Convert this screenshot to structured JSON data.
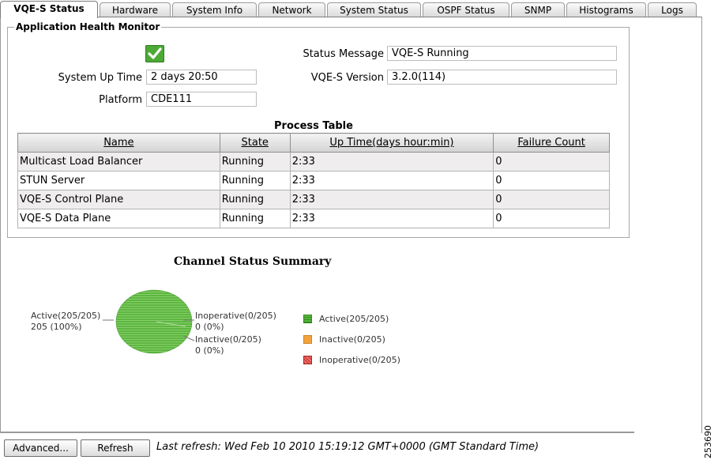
{
  "tabs": [
    {
      "label": "VQE-S Status",
      "active": true
    },
    {
      "label": "Hardware"
    },
    {
      "label": "System Info"
    },
    {
      "label": "Network"
    },
    {
      "label": "System Status"
    },
    {
      "label": "OSPF Status"
    },
    {
      "label": "SNMP"
    },
    {
      "label": "Histograms"
    },
    {
      "label": "Logs"
    }
  ],
  "health": {
    "legend": "Application Health Monitor",
    "status_ok": true,
    "uptime_label": "System Up Time",
    "uptime_value": "2 days 20:50",
    "platform_label": "Platform",
    "platform_value": "CDE111",
    "status_msg_label": "Status Message",
    "status_msg_value": "VQE-S Running",
    "version_label": "VQE-S Version",
    "version_value": "3.2.0(114)"
  },
  "process_table": {
    "title": "Process Table",
    "columns": [
      "Name",
      "State",
      "Up Time(days hour:min)",
      "Failure Count"
    ],
    "rows": [
      [
        "Multicast Load Balancer",
        "Running",
        "2:33",
        "0"
      ],
      [
        "STUN Server",
        "Running",
        "2:33",
        "0"
      ],
      [
        "VQE-S Control Plane",
        "Running",
        "2:33",
        "0"
      ],
      [
        "VQE-S Data Plane",
        "Running",
        "2:33",
        "0"
      ]
    ]
  },
  "chart_data": {
    "type": "pie",
    "title": "Channel Status Summary",
    "categories": [
      "Active",
      "Inactive",
      "Inoperative"
    ],
    "values": [
      205,
      0,
      0
    ],
    "slice_labels": [
      {
        "line1": "Active(205/205)",
        "line2": "205 (100%)"
      },
      {
        "line1": "Inactive(0/205)",
        "line2": "0 (0%)"
      },
      {
        "line1": "Inoperative(0/205)",
        "line2": "0 (0%)"
      }
    ],
    "legend": [
      "Active(205/205)",
      "Inactive(0/205)",
      "Inoperative(0/205)"
    ],
    "colors": [
      "#5cb63f",
      "#f2a33a",
      "#d9433f"
    ],
    "legend_position": "right"
  },
  "footer": {
    "advanced_label": "Advanced...",
    "refresh_label": "Refresh",
    "last_refresh": "Last refresh: Wed Feb 10 2010 15:19:12 GMT+0000 (GMT Standard Time)"
  },
  "figure_id": "253690"
}
